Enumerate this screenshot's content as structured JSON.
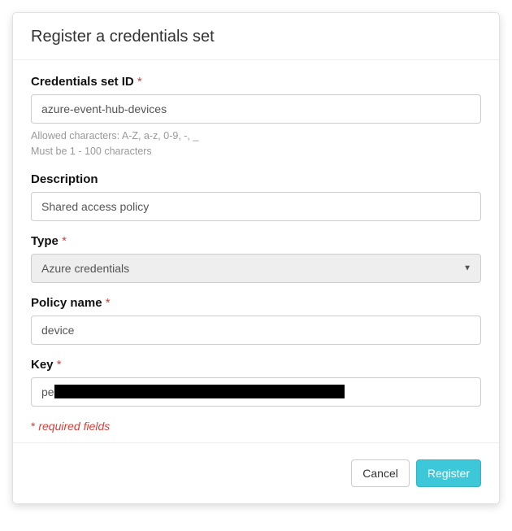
{
  "header": {
    "title": "Register a credentials set"
  },
  "form": {
    "credentials_id": {
      "label": "Credentials set ID",
      "required": true,
      "value": "azure-event-hub-devices",
      "help1": "Allowed characters: A-Z, a-z, 0-9, -, _",
      "help2": "Must be 1 - 100 characters"
    },
    "description": {
      "label": "Description",
      "required": false,
      "value": "Shared access policy"
    },
    "type": {
      "label": "Type",
      "required": true,
      "value": "Azure credentials"
    },
    "policy_name": {
      "label": "Policy name",
      "required": true,
      "value": "device"
    },
    "key": {
      "label": "Key",
      "required": true,
      "prefix": "pe"
    },
    "required_note_ast": "*",
    "required_note_text": "  required fields"
  },
  "footer": {
    "cancel_label": "Cancel",
    "register_label": "Register"
  },
  "asterisk": " *"
}
